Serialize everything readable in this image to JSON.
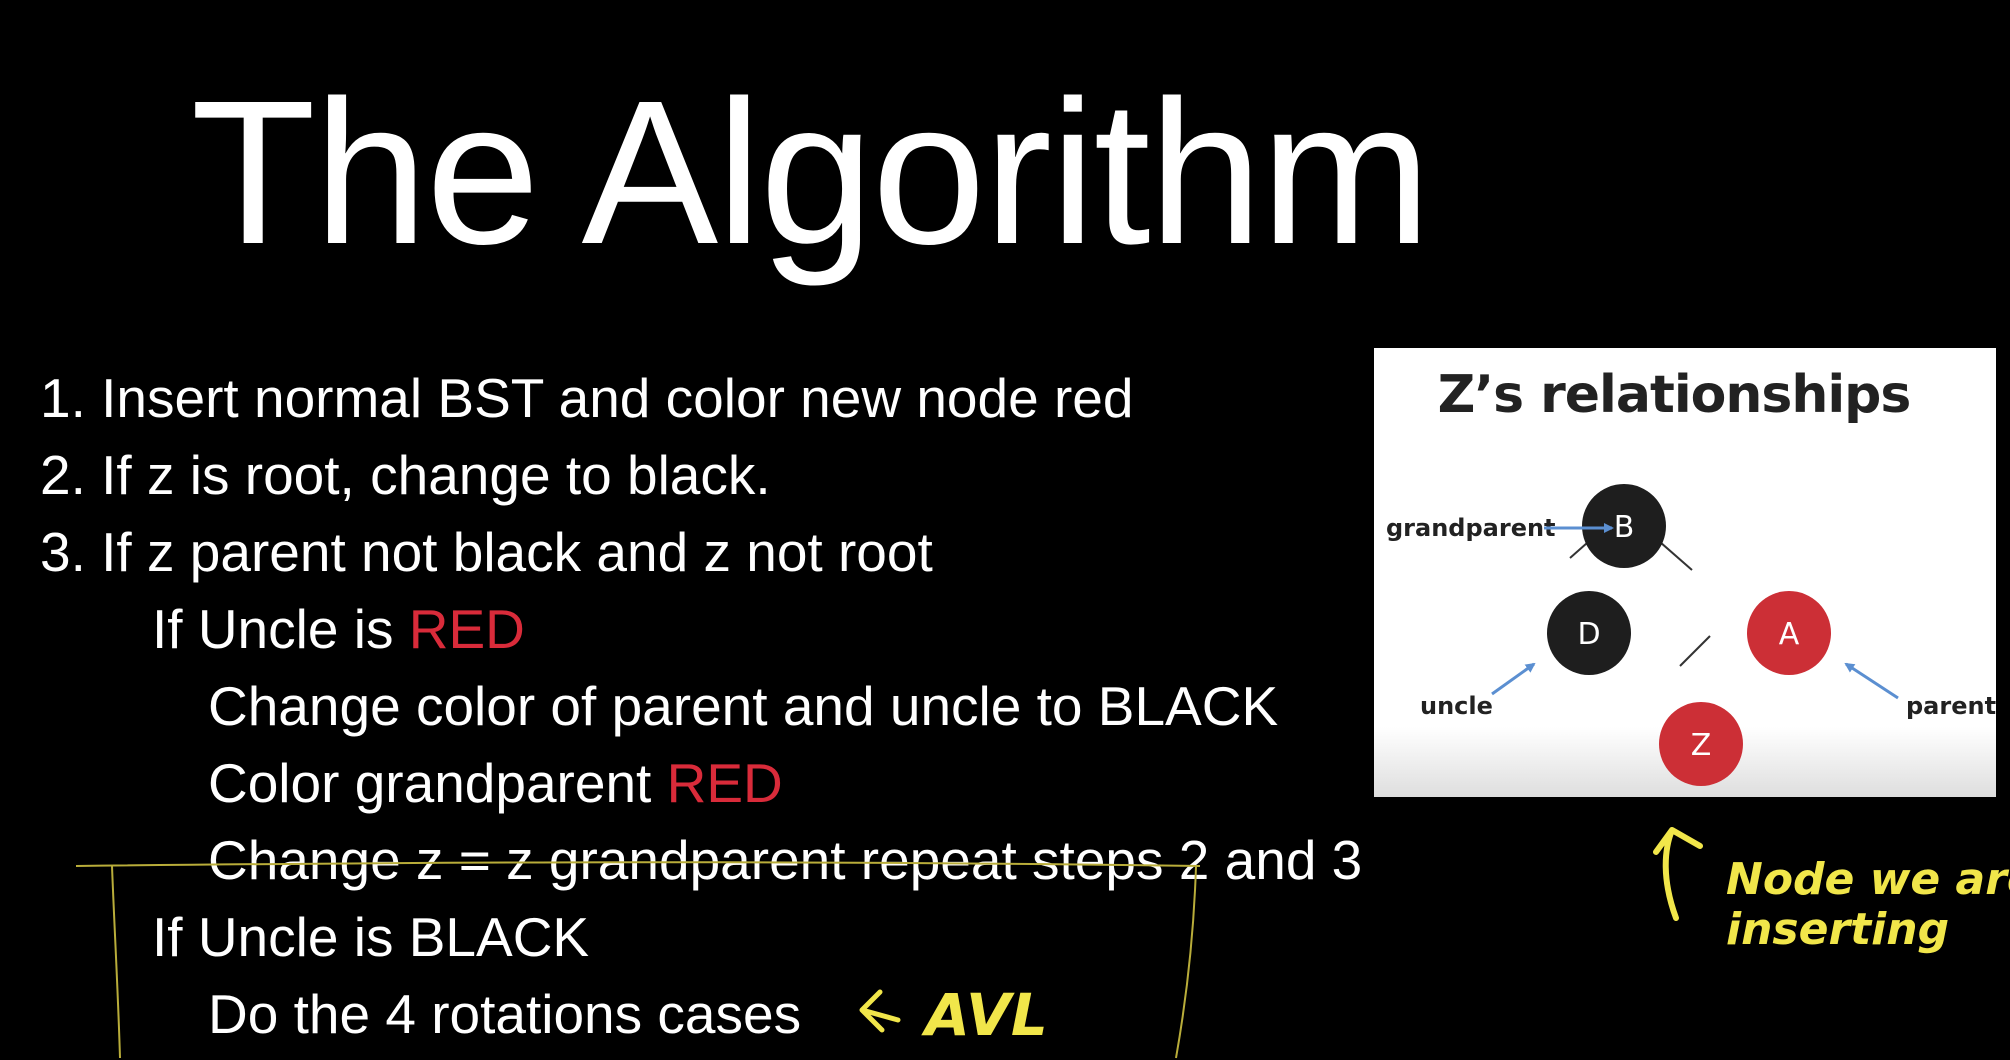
{
  "title": "The Algorithm",
  "steps": [
    "1. Insert normal BST and color new node red",
    "2. If z is root, change to black.",
    "3. If z parent not black and z not root"
  ],
  "uncle_red": {
    "prefix": "If Uncle is ",
    "color_word": "RED",
    "actions": {
      "change_color": "Change color of parent and uncle to BLACK",
      "color_grandparent_prefix": "Color grandparent ",
      "color_grandparent_word": "RED",
      "repeat": "Change z = z grandparent repeat steps 2 and 3"
    }
  },
  "uncle_black": {
    "label": "If Uncle is BLACK",
    "action": "Do the 4 rotations cases"
  },
  "figure": {
    "title": "Z’s relationships",
    "nodes": {
      "b": "B",
      "d": "D",
      "a": "A",
      "z": "Z"
    },
    "labels": {
      "grandparent": "grandparent",
      "uncle": "uncle",
      "parent": "parent"
    }
  },
  "annotations": {
    "avl": "AVL",
    "node_line1": "Node we are",
    "node_line2": "inserting"
  },
  "colors": {
    "background": "#000000",
    "text": "#ffffff",
    "red": "#d92b3a",
    "black_node": "#1e1e1e",
    "red_node": "#cc2f36",
    "arrow_blue": "#5b8fd1",
    "annotation_yellow": "#f1e64a"
  }
}
